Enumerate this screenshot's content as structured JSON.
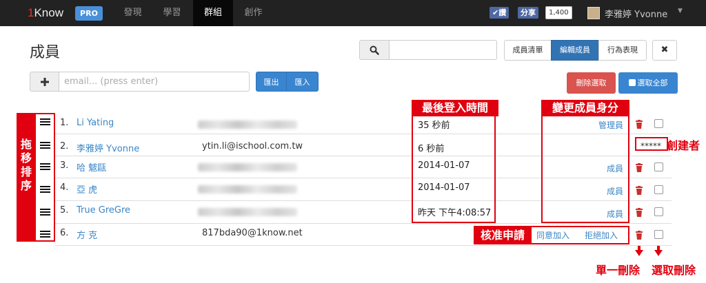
{
  "nav": {
    "brand_one": "1",
    "brand_rest": "Know",
    "pro": "PRO",
    "items": [
      "發現",
      "學習",
      "群組",
      "創作"
    ],
    "fb_like": "✔讚",
    "fb_share": "分享",
    "fb_count": "1,400",
    "user_name": "李雅婷 Yvonne"
  },
  "page": {
    "title": "成員",
    "segments": [
      "成員清單",
      "編輯成員",
      "行為表現"
    ],
    "active_segment": "編輯成員",
    "close": "✖",
    "email_placeholder": "email... (press enter)",
    "export": "匯出",
    "import": "匯入",
    "delete_selected": "刪除選取",
    "select_all": "選取全部"
  },
  "members": [
    {
      "num": "1.",
      "name": "Li Yating",
      "email": "",
      "login": "35 秒前",
      "role": "管理員"
    },
    {
      "num": "2.",
      "name": "李雅婷 Yvonne",
      "email": "ytin.li@ischool.com.tw",
      "login": "6 秒前",
      "role": ""
    },
    {
      "num": "3.",
      "name": "哈 魃甌",
      "email": "",
      "login": "2014-01-07",
      "role": "成員"
    },
    {
      "num": "4.",
      "name": "亞 虎",
      "email": "",
      "login": "2014-01-07",
      "role": "成員"
    },
    {
      "num": "5.",
      "name": "True GreGre",
      "email": "",
      "login": "昨天 下午4:08:57",
      "role": "成員"
    },
    {
      "num": "6.",
      "name": "方 克",
      "email": "817bda90@1know.net",
      "login": "",
      "role": ""
    }
  ],
  "creator_mark": "*****",
  "approve": "同意加入",
  "reject": "拒絕加入",
  "annotations": {
    "drag_sort": "拖移排序",
    "last_login": "最後登入時間",
    "change_role": "變更成員身分",
    "creator": "創建者",
    "approve_request": "核准申請",
    "single_delete": "單一刪除",
    "select_delete": "選取刪除"
  },
  "colors": {
    "accent": "#3a85d0",
    "danger": "#d9534f",
    "annotation": "#e0000f"
  },
  "icons": [
    "search-icon",
    "plus-icon",
    "drag-handle-icon",
    "trash-icon",
    "checkbox",
    "caret-down-icon"
  ]
}
